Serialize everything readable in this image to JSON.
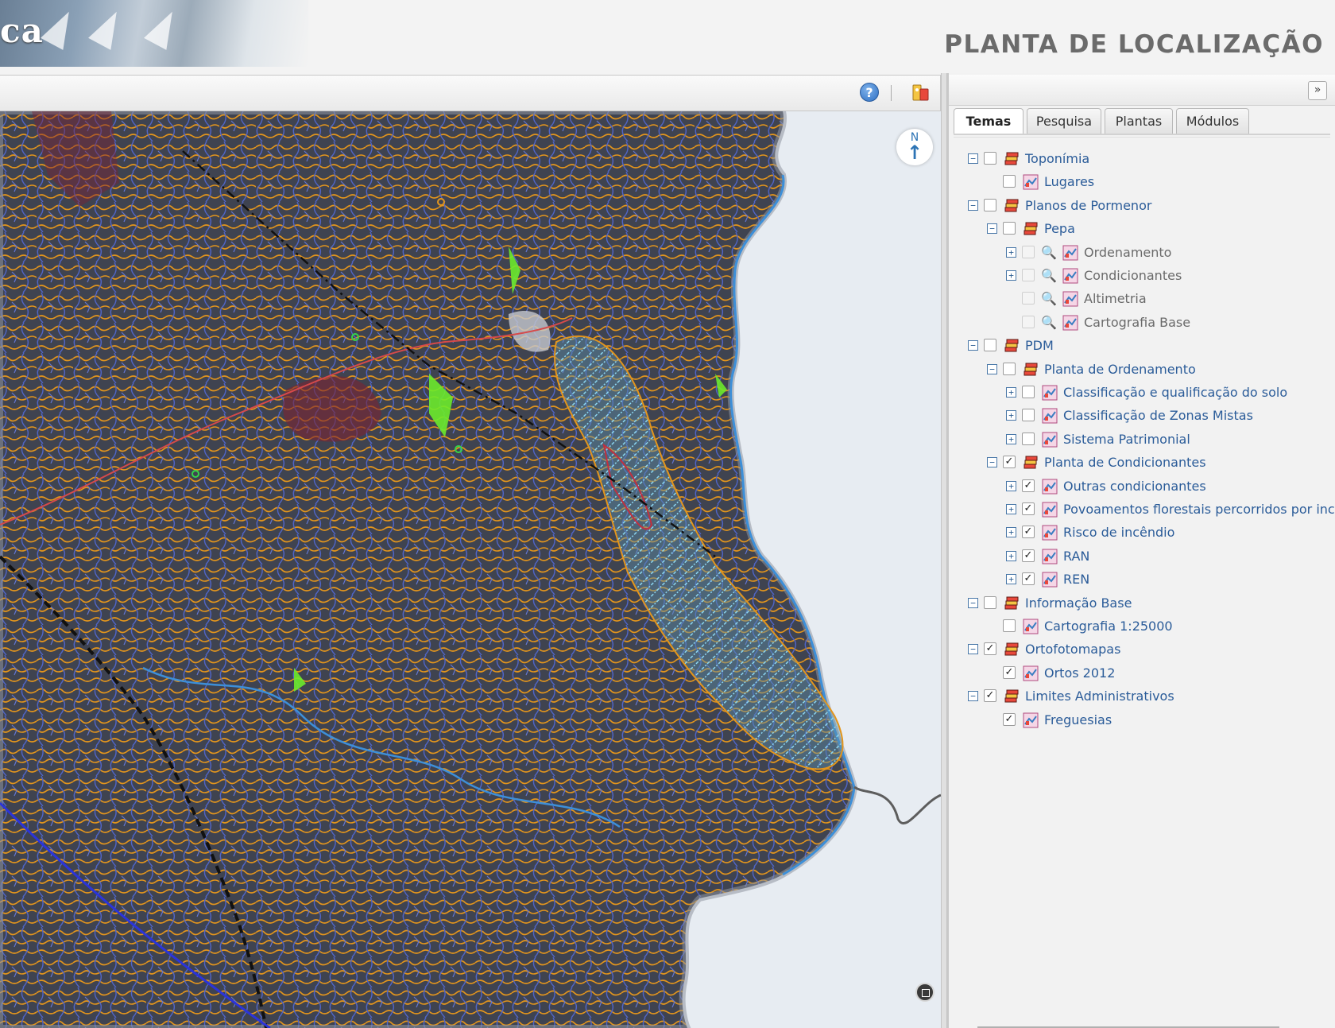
{
  "header": {
    "logo_text": "ca",
    "title": "PLANTA DE LOCALIZAÇÃO"
  },
  "map": {
    "toolbar": {
      "help_symbol": "?"
    },
    "north_arrow": {
      "letter": "N",
      "arrow": "↑"
    }
  },
  "side_panel": {
    "collapse_symbol": "»",
    "tabs": [
      {
        "label": "Temas",
        "active": true
      },
      {
        "label": "Pesquisa",
        "active": false
      },
      {
        "label": "Plantas",
        "active": false
      },
      {
        "label": "Módulos",
        "active": false
      }
    ],
    "tree": [
      {
        "label": "Toponímia",
        "level": 0,
        "expander": "collapse",
        "checked": false,
        "type": "group"
      },
      {
        "label": "Lugares",
        "level": 1,
        "expander": "none",
        "checked": false,
        "type": "layer"
      },
      {
        "label": "Planos de Pormenor",
        "level": 0,
        "expander": "collapse",
        "checked": false,
        "type": "group"
      },
      {
        "label": "Pepa",
        "level": 1,
        "expander": "collapse",
        "checked": false,
        "type": "group"
      },
      {
        "label": "Ordenamento",
        "level": 2,
        "expander": "expand",
        "checked": false,
        "type": "layer",
        "zoom": true,
        "disabled": true
      },
      {
        "label": "Condicionantes",
        "level": 2,
        "expander": "expand",
        "checked": false,
        "type": "layer",
        "zoom": true,
        "disabled": true
      },
      {
        "label": "Altimetria",
        "level": 2,
        "expander": "none",
        "checked": false,
        "type": "layer",
        "zoom": true,
        "disabled": true
      },
      {
        "label": "Cartografia Base",
        "level": 2,
        "expander": "none",
        "checked": false,
        "type": "layer",
        "zoom": true,
        "disabled": true
      },
      {
        "label": "PDM",
        "level": 0,
        "expander": "collapse",
        "checked": false,
        "type": "group"
      },
      {
        "label": "Planta de Ordenamento",
        "level": 1,
        "expander": "collapse",
        "checked": false,
        "type": "group"
      },
      {
        "label": "Classificação e qualificação do solo",
        "level": 2,
        "expander": "expand",
        "checked": false,
        "type": "layer"
      },
      {
        "label": "Classificação de Zonas Mistas",
        "level": 2,
        "expander": "expand",
        "checked": false,
        "type": "layer"
      },
      {
        "label": "Sistema Patrimonial",
        "level": 2,
        "expander": "expand",
        "checked": false,
        "type": "layer"
      },
      {
        "label": "Planta de Condicionantes",
        "level": 1,
        "expander": "collapse",
        "checked": true,
        "type": "group"
      },
      {
        "label": "Outras condicionantes",
        "level": 2,
        "expander": "expand",
        "checked": true,
        "type": "layer"
      },
      {
        "label": "Povoamentos florestais percorridos por incên",
        "level": 2,
        "expander": "expand",
        "checked": true,
        "type": "layer"
      },
      {
        "label": "Risco de incêndio",
        "level": 2,
        "expander": "expand",
        "checked": true,
        "type": "layer"
      },
      {
        "label": "RAN",
        "level": 2,
        "expander": "expand",
        "checked": true,
        "type": "layer"
      },
      {
        "label": "REN",
        "level": 2,
        "expander": "expand",
        "checked": true,
        "type": "layer"
      },
      {
        "label": "Informação Base",
        "level": 0,
        "expander": "collapse",
        "checked": false,
        "type": "group"
      },
      {
        "label": "Cartografia 1:25000",
        "level": 1,
        "expander": "none",
        "checked": false,
        "type": "layer"
      },
      {
        "label": "Ortofotomapas",
        "level": 0,
        "expander": "collapse",
        "checked": true,
        "type": "group"
      },
      {
        "label": "Ortos 2012",
        "level": 1,
        "expander": "none",
        "checked": true,
        "type": "layer"
      },
      {
        "label": "Limites Administrativos",
        "level": 0,
        "expander": "collapse",
        "checked": true,
        "type": "group"
      },
      {
        "label": "Freguesias",
        "level": 1,
        "expander": "none",
        "checked": true,
        "type": "layer"
      }
    ]
  },
  "colors": {
    "contour_orange": "#e3951c",
    "stream_blue": "#4f66c8",
    "river_blue": "#3d8fd8",
    "sea": "#e7ecf2",
    "land_dark": "#3b3f4a",
    "tree_link": "#2b5c99",
    "title_gray": "#6b6b6b"
  }
}
